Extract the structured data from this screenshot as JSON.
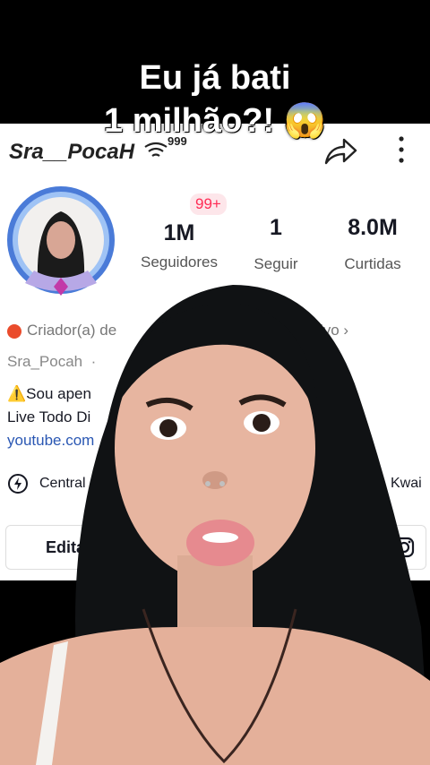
{
  "caption": {
    "line1": "Eu já bati",
    "line2": "1 milhão?! 😱"
  },
  "profile": {
    "username": "Sra__PocaH",
    "signal_badge": "999",
    "notification_badge": "99+",
    "stats": [
      {
        "value": "1M",
        "label": "Seguidores"
      },
      {
        "value": "1",
        "label": "Seguir"
      },
      {
        "value": "8.0M",
        "label": "Curtidas"
      }
    ],
    "creator_text_start": "Criador(a) de",
    "creator_text_end": "istintivo ›",
    "handle": "Sra_Pocah",
    "handle_dot": "·",
    "bio_line1": "⚠️Sou apen",
    "bio_line2": "Live Todo Di",
    "link": "youtube.com",
    "central_label": "Central d",
    "kwai_label": "Kwai",
    "edit_button": "Editar",
    "colors": {
      "accent": "#ff2b54",
      "link": "#2a57b3",
      "verified": "#ea4c2c"
    }
  },
  "icons": [
    "share-icon",
    "more-icon",
    "location-icon",
    "shopping-bag-icon",
    "instagram-icon",
    "wifi-icon"
  ]
}
